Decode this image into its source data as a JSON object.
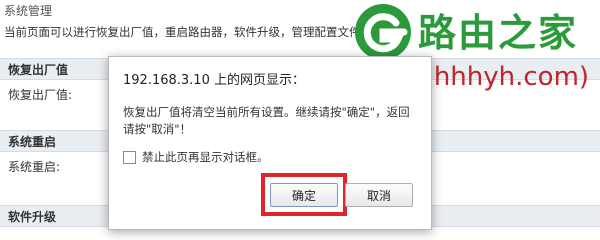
{
  "page": {
    "title": "系统管理",
    "description": "当前页面可以进行恢复出厂值，重启路由器，软件升级，管理配置文件等",
    "description_tail": "。"
  },
  "sections": [
    {
      "header": "恢复出厂值",
      "field": "恢复出厂值:"
    },
    {
      "header": "系统重启",
      "field": "系统重启:"
    },
    {
      "header": "软件升级"
    }
  ],
  "watermark": {
    "brand": "路由之家",
    "url": "(www.hhhyh.com)",
    "colors": {
      "green": "#2a9a3a",
      "red": "#c0252b"
    }
  },
  "dialog": {
    "title": "192.168.3.10 上的网页显示：",
    "message": "恢复出厂值将清空当前所有设置。继续请按\"确定\"，返回请按\"取消\"！",
    "checkbox_label": "禁止此页再显示对话框。",
    "checkbox_checked": false,
    "ok_label": "确定",
    "cancel_label": "取消",
    "highlight_color": "#e0262b"
  }
}
